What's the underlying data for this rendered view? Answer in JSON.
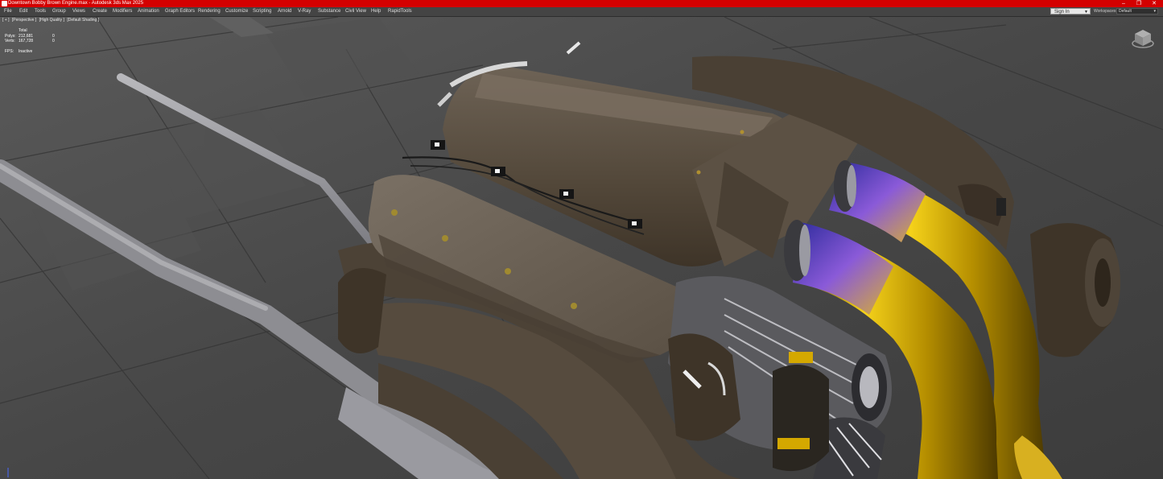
{
  "window": {
    "title": "Downtown Bobby Brown Engine.max - Autodesk 3ds Max 2025",
    "controls": [
      "–",
      "❐",
      "✕"
    ]
  },
  "menu": [
    "File",
    "Edit",
    "Tools",
    "Group",
    "Views",
    "Create",
    "Modifiers",
    "Animation",
    "Graph Editors",
    "Rendering",
    "Customize",
    "Scripting",
    "Arnold",
    "V-Ray",
    "Substance",
    "Civil View",
    "Help",
    "RapidTools"
  ],
  "account": {
    "signin_label": "Sign In"
  },
  "workspace": {
    "label": "Workspaces:",
    "value": "Default"
  },
  "viewport": {
    "labels": [
      "[ + ]",
      "[Perspective ]",
      "[High Quality ]",
      "[Default Shading ]"
    ],
    "stats": {
      "header": "Total",
      "polys_label": "Polys:",
      "polys_value": "212,681",
      "polys_sel": "0",
      "verts_label": "Verts:",
      "verts_value": "167,728",
      "verts_sel": "0",
      "fps_label": "FPS:",
      "fps_value": "Inactive"
    }
  },
  "colors": {
    "titlebar": "#d40000",
    "menubar": "#444444",
    "engine_bronze": "#5a4e40",
    "pipe_gold": "#c9a100",
    "pipe_titanium": "#5a48c8"
  }
}
